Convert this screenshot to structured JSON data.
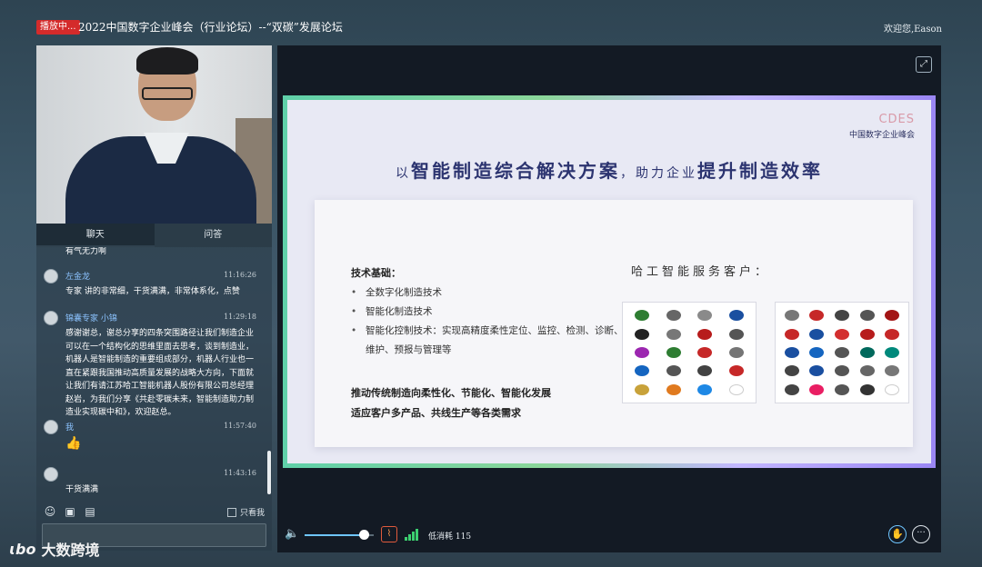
{
  "topbar": {
    "live_badge": "播放中...",
    "title": "2022中国数字企业峰会（行业论坛）--“双碳”发展论坛",
    "welcome": "欢迎您,Eason"
  },
  "chat": {
    "tabs": [
      {
        "label": "聊天"
      },
      {
        "label": "问答"
      }
    ],
    "messages": [
      {
        "text": "有气无力啊"
      },
      {
        "name": "左金龙",
        "time": "11:16:26",
        "text": "专家 讲的非常细，干货满满，非常体系化，点赞"
      },
      {
        "name": "锦囊专家 小锦",
        "time": "11:29:18",
        "text": "感谢谢总，谢总分享的四条突围路径让我们制造企业可以在一个结构化的思维里面去思考，谈到制造业，机器人是智能制造的重要组成部分，机器人行业也一直在紧跟我国推动高质量发展的战略大方向，下面就让我们有请江苏哈工智能机器人股份有限公司总经理赵岩，为我们分享《共赴零碳未来，智能制造助力制造业实现碳中和》，欢迎赵总。"
      },
      {
        "name": "我",
        "time": "11:57:40",
        "text": "👍"
      },
      {
        "name": "",
        "time": "11:43:16",
        "text": "干货满满"
      }
    ],
    "only_me_label": "只看我",
    "input_placeholder": ""
  },
  "slide": {
    "logo_mark": "CDES",
    "logo_sub": "中国数字企业峰会",
    "headline_pre": "以",
    "headline_hl1": "智能制造综合解决方案",
    "headline_mid": "，助力企业",
    "headline_hl2": "提升制造效率",
    "tech_title": "技术基础：",
    "bullets": [
      "全数字化制造技术",
      "智能化制造技术",
      "智能化控制技术：实现高精度柔性定位、监控、检测、诊断、维护、预报与管理等"
    ],
    "push_line_1": "推动传统制造向柔性化、节能化、智能化发展",
    "push_line_2": "适应客户多产品、共线生产等各类需求",
    "clients_title": "哈工智能服务客户：",
    "client_logo_colors_a": [
      "#2e7d32",
      "#666666",
      "#8a8a8a",
      "#1a4fa0",
      "#222222",
      "#777777",
      "#b71c1c",
      "#555555",
      "#9c27b0",
      "#2e7d32",
      "#c62828",
      "#757575",
      "#1565c0",
      "#555555",
      "#424242",
      "#c62828",
      "#c8a23a",
      "#e07a1f",
      "#1e88e5",
      "#ffffff"
    ],
    "client_logo_colors_b": [
      "#777777",
      "#c62828",
      "#444444",
      "#555555",
      "#a31515",
      "#c62828",
      "#1a4fa0",
      "#d32f2f",
      "#b71c1c",
      "#c62828",
      "#1a4fa0",
      "#1565c0",
      "#555555",
      "#00695c",
      "#00897b",
      "#444444",
      "#1a4fa0",
      "#555555",
      "#666666",
      "#777777",
      "#444444",
      "#e91e63",
      "#555555",
      "#333333",
      "#ffffff"
    ]
  },
  "controls": {
    "volume_level": 0.85,
    "latency_label": "低消耗 115"
  },
  "watermark": {
    "mark": "ɩbo",
    "text": "大数跨境"
  }
}
